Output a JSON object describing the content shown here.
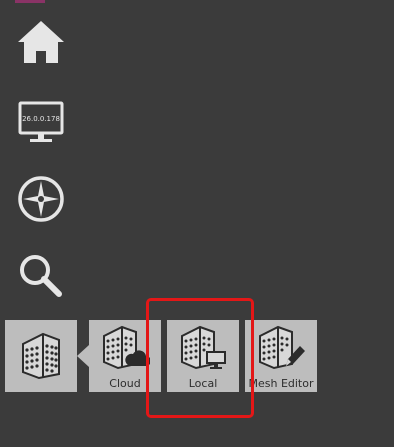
{
  "sidebar": {
    "items": [
      {
        "icon": "home-icon"
      },
      {
        "icon": "monitor-icon",
        "ip_text": "26.0.0.178"
      },
      {
        "icon": "compass-icon"
      },
      {
        "icon": "search-icon"
      }
    ]
  },
  "popup": {
    "main_icon": "building-grid-icon",
    "tiles": [
      {
        "label": "Cloud",
        "icon": "building-cloud-icon"
      },
      {
        "label": "Local",
        "icon": "building-monitor-icon"
      },
      {
        "label": "Mesh Editor",
        "icon": "building-pencil-icon"
      }
    ]
  },
  "colors": {
    "background": "#3b3b3b",
    "icon": "#e6e6e6",
    "tile": "#bdbdbd",
    "tile_icon": "#2b2b2b",
    "highlight": "#e31717",
    "top_tab": "#8a3366"
  }
}
